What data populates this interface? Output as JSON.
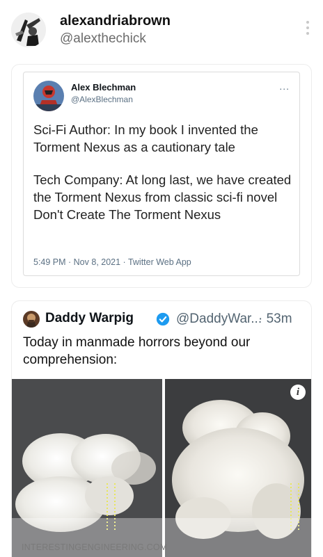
{
  "top": {
    "name": "alexandriabrown",
    "handle": "@alexthechick",
    "more_icon": "vertical-ellipsis-icon"
  },
  "quoted": {
    "name": "Alex Blechman",
    "handle": "@AlexBlechman",
    "more": "...",
    "paragraph1": "Sci-Fi Author: In my book I invented the Torment Nexus as a cautionary tale",
    "paragraph2": "Tech Company: At long last, we have created the Torment Nexus from classic sci-fi novel Don't Create The Torment Nexus",
    "meta": "5:49 PM · Nov 8, 2021 · Twitter Web App"
  },
  "tweet": {
    "name": "Daddy Warpig",
    "handle": "@DaddyWar...",
    "time": "· 53m",
    "text": "Today in manmade horrors beyond our comprehension:",
    "info_label": "i",
    "media_source": "INTERESTINGENGINEERING.COM",
    "verified_color": "#1d9bf0"
  }
}
